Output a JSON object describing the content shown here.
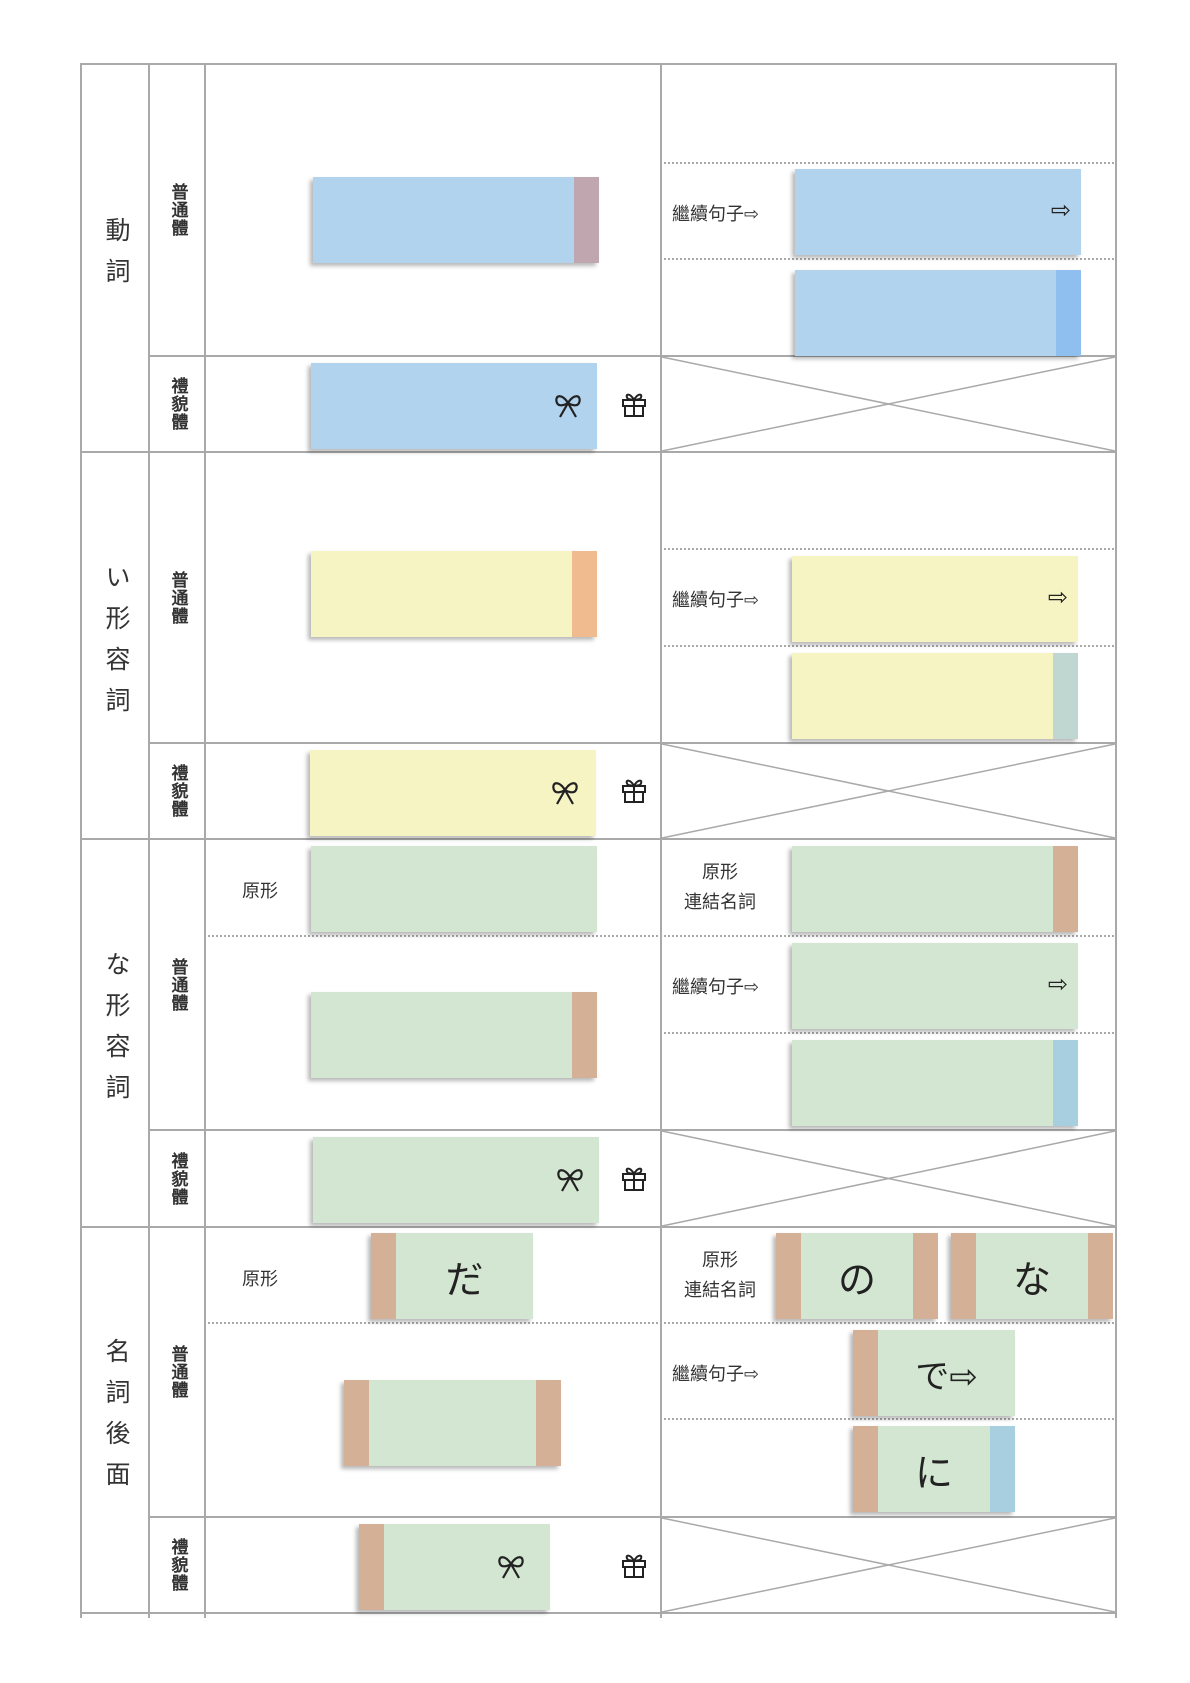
{
  "categories": {
    "verb": "動詞",
    "i_adj": "い形容詞",
    "na_adj": "な形容詞",
    "noun": "名詞後面"
  },
  "registers": {
    "plain": "普通體",
    "polite": "禮貌體"
  },
  "labels": {
    "continue": "繼續句子⇨",
    "base": "原形",
    "noun_link": "連結名詞"
  },
  "symbols": {
    "arrow": "⇨",
    "bow_icon": "bow-icon",
    "gift_icon": "gift-icon"
  },
  "noun_cards": {
    "da": "だ",
    "no": "の",
    "na": "な",
    "de": "で⇨",
    "ni": "に"
  },
  "colors": {
    "verb": "#b2d3ee",
    "i_adj": "#f7f4c4",
    "na_adj_noun": "#d3e6d2",
    "grid": "#a9a9a9",
    "tab_mauve": "#c0a7af",
    "tab_orange": "#f1bb90",
    "tab_tan": "#d4b097",
    "tab_sky": "#8fbfef",
    "tab_steel": "#a7cfe0",
    "tab_grey": "#c0d6d1"
  }
}
